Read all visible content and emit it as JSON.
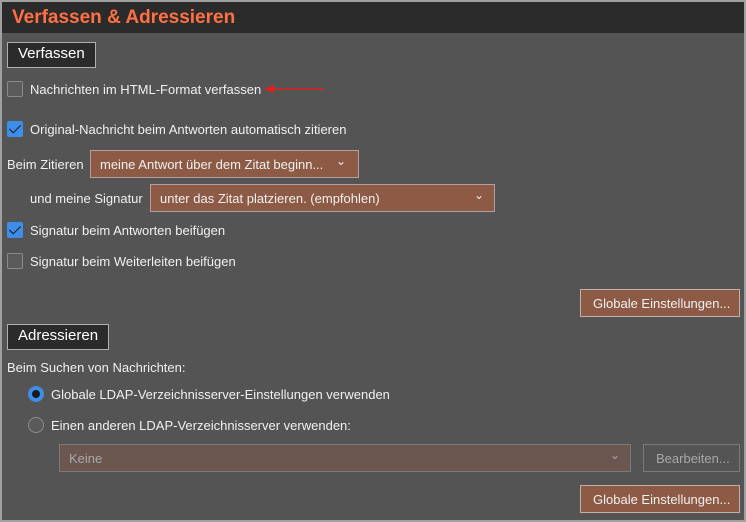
{
  "title": "Verfassen & Adressieren",
  "compose": {
    "section": "Verfassen",
    "html_format": {
      "label": "Nachrichten im HTML-Format verfassen",
      "checked": false
    },
    "auto_quote": {
      "label": "Original-Nachricht beim Antworten automatisch zitieren",
      "checked": true
    },
    "quote_label": "Beim Zitieren",
    "quote_value": "meine Antwort über dem Zitat beginn...",
    "signature_label": "und meine Signatur",
    "signature_value": "unter das Zitat platzieren. (empfohlen)",
    "sig_reply": {
      "label": "Signatur beim Antworten beifügen",
      "checked": true
    },
    "sig_forward": {
      "label": "Signatur beim Weiterleiten beifügen",
      "checked": false
    },
    "global_button": "Globale Einstellungen..."
  },
  "addressing": {
    "section": "Adressieren",
    "search_label": "Beim Suchen von Nachrichten:",
    "radio_global": {
      "label": "Globale LDAP-Verzeichnisserver-Einstellungen verwenden",
      "selected": true
    },
    "radio_other": {
      "label": "Einen anderen LDAP-Verzeichnisserver verwenden:",
      "selected": false
    },
    "server_value": "Keine",
    "edit_button": "Bearbeiten...",
    "global_button": "Globale Einstellungen..."
  },
  "colors": {
    "accent": "#ff7043",
    "control": "#8d5a45",
    "check": "#3d8ee8"
  }
}
